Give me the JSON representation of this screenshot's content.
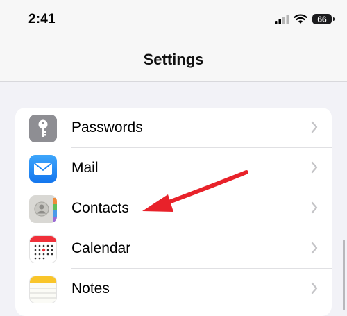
{
  "status_bar": {
    "time": "2:41",
    "battery_level": "66"
  },
  "nav": {
    "title": "Settings"
  },
  "settings_items": [
    {
      "label": "Passwords",
      "icon": "key-icon"
    },
    {
      "label": "Mail",
      "icon": "mail-icon"
    },
    {
      "label": "Contacts",
      "icon": "contacts-icon"
    },
    {
      "label": "Calendar",
      "icon": "calendar-icon"
    },
    {
      "label": "Notes",
      "icon": "notes-icon"
    }
  ],
  "colors": {
    "accent_arrow": "#e8222a",
    "chevron": "#c4c4c7",
    "mail_blue": "#1e88f5",
    "calendar_red": "#f0303a",
    "notes_yellow": "#f9c52a"
  }
}
